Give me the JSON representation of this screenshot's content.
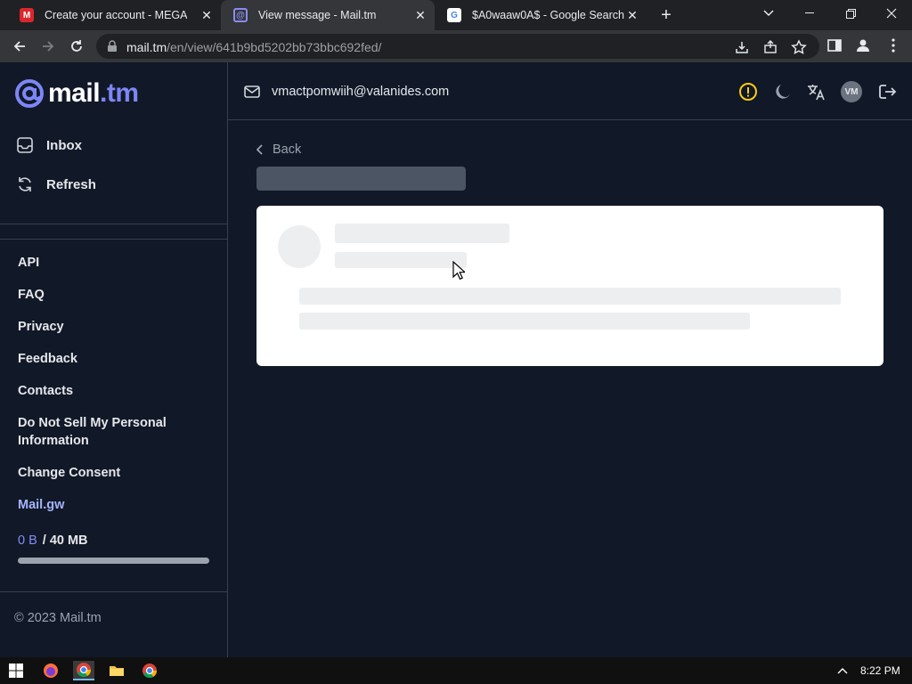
{
  "browser": {
    "tabs": [
      {
        "title": "Create your account - MEGA",
        "favicon": "mega-icon",
        "active": false
      },
      {
        "title": "View message - Mail.tm",
        "favicon": "mailtm-icon",
        "active": true
      },
      {
        "title": "$A0waaw0A$ - Google Search",
        "favicon": "google-icon",
        "active": false
      }
    ],
    "url_host": "mail.tm",
    "url_path": "/en/view/641b9bd5202bb73bbc692fed/"
  },
  "sidebar": {
    "logo_text": "mail",
    "logo_tld": ".tm",
    "nav": [
      {
        "label": "Inbox",
        "icon": "inbox-icon"
      },
      {
        "label": "Refresh",
        "icon": "refresh-icon"
      }
    ],
    "links": [
      {
        "label": "API"
      },
      {
        "label": "FAQ"
      },
      {
        "label": "Privacy"
      },
      {
        "label": "Feedback"
      },
      {
        "label": "Contacts"
      },
      {
        "label": "Do Not Sell My Personal Information"
      },
      {
        "label": "Change Consent"
      },
      {
        "label": "Mail.gw"
      }
    ],
    "storage_used": "0 B",
    "storage_total": "/ 40 MB",
    "storage_fraction": 0,
    "copyright": "© 2023 Mail.tm"
  },
  "header": {
    "email": "vmactpomwiih@valanides.com",
    "avatar_initials": "VM"
  },
  "main": {
    "back_label": "Back"
  },
  "taskbar": {
    "time": "8:22 PM"
  },
  "colors": {
    "accent": "#818cf8",
    "background": "#111827",
    "warning": "#facc15"
  }
}
